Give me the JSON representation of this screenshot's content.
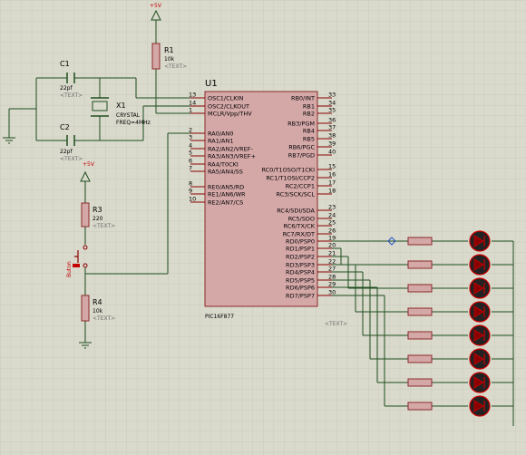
{
  "power": {
    "top_supply": "+5V",
    "button_supply": "+5V"
  },
  "components": {
    "r1": {
      "ref": "R1",
      "value": "10k",
      "text": "<TEXT>"
    },
    "r3": {
      "ref": "R3",
      "value": "220",
      "text": "<TEXT>"
    },
    "r4": {
      "ref": "R4",
      "value": "10k",
      "text": "<TEXT>"
    },
    "c1": {
      "ref": "C1",
      "value": "22pf",
      "text": "<TEXT>"
    },
    "c2": {
      "ref": "C2",
      "value": "22pf",
      "text": "<TEXT>"
    },
    "x1": {
      "ref": "X1",
      "type": "CRYSTAL",
      "freq": "FREQ=4MHz"
    },
    "button": {
      "label": "Buton"
    },
    "u1": {
      "ref": "U1",
      "part": "PIC16F877",
      "text": "<TEXT>"
    }
  },
  "ic_pins_left": [
    {
      "num": "13",
      "name": "OSC1/CLKIN"
    },
    {
      "num": "14",
      "name": "OSC2/CLKOUT"
    },
    {
      "num": "1",
      "name": "MCLR/Vpp/THV"
    },
    {
      "num": "2",
      "name": "RA0/AN0"
    },
    {
      "num": "3",
      "name": "RA1/AN1"
    },
    {
      "num": "4",
      "name": "RA2/AN2/VREF-"
    },
    {
      "num": "5",
      "name": "RA3/AN3/VREF+"
    },
    {
      "num": "6",
      "name": "RA4/T0CKI"
    },
    {
      "num": "7",
      "name": "RA5/AN4/SS"
    },
    {
      "num": "8",
      "name": "RE0/AN5/RD"
    },
    {
      "num": "9",
      "name": "RE1/AN6/WR"
    },
    {
      "num": "10",
      "name": "RE2/AN7/CS"
    }
  ],
  "ic_pins_right": [
    {
      "num": "33",
      "name": "RB0/INT"
    },
    {
      "num": "34",
      "name": "RB1"
    },
    {
      "num": "35",
      "name": "RB2"
    },
    {
      "num": "36",
      "name": "RB3/PGM"
    },
    {
      "num": "37",
      "name": "RB4"
    },
    {
      "num": "38",
      "name": "RB5"
    },
    {
      "num": "39",
      "name": "RB6/PGC"
    },
    {
      "num": "40",
      "name": "RB7/PGD"
    },
    {
      "num": "15",
      "name": "RC0/T1OSO/T1CKI"
    },
    {
      "num": "16",
      "name": "RC1/T1OSI/CCP2"
    },
    {
      "num": "17",
      "name": "RC2/CCP1"
    },
    {
      "num": "18",
      "name": "RC3/SCK/SCL"
    },
    {
      "num": "23",
      "name": "RC4/SDI/SDA"
    },
    {
      "num": "24",
      "name": "RC5/SDO"
    },
    {
      "num": "25",
      "name": "RC6/TX/CK"
    },
    {
      "num": "26",
      "name": "RC7/RX/DT"
    },
    {
      "num": "19",
      "name": "RD0/PSP0"
    },
    {
      "num": "20",
      "name": "RD1/PSP1"
    },
    {
      "num": "21",
      "name": "RD2/PSP2"
    },
    {
      "num": "22",
      "name": "RD3/PSP3"
    },
    {
      "num": "27",
      "name": "RD4/PSP4"
    },
    {
      "num": "28",
      "name": "RD5/PSP5"
    },
    {
      "num": "29",
      "name": "RD6/PSP6"
    },
    {
      "num": "30",
      "name": "RD7/PSP7"
    }
  ],
  "colors": {
    "background": "#d9d9cc",
    "grid": "#c6c6b8",
    "wire": "#1f4f1f",
    "body": "#d5a8a8",
    "body_border": "#8b2a2a",
    "pin": "#8b0000",
    "led": "#222222",
    "led_outline": "#cc0000",
    "junction": "#2a55c8",
    "text_placeholder": "#6f6f6f"
  }
}
